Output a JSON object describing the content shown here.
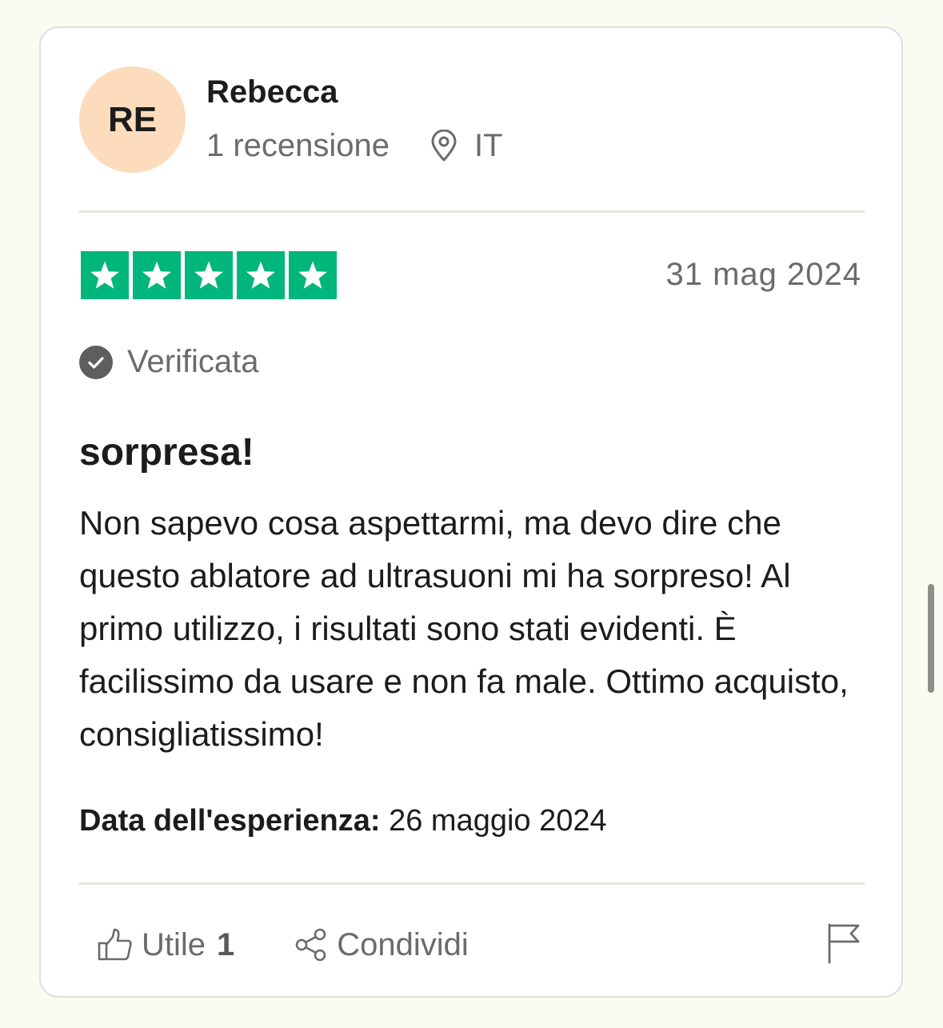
{
  "reviewer": {
    "initials": "RE",
    "name": "Rebecca",
    "review_count": "1 recensione",
    "country": "IT",
    "avatar_color": "#fcdcbc"
  },
  "review": {
    "rating": 5,
    "rating_max": 5,
    "star_color": "#00b67a",
    "date": "31 mag 2024",
    "verified_label": "Verificata",
    "title": "sorpresa!",
    "body": "Non sapevo cosa aspettarmi, ma devo dire che questo ablatore ad ultrasuoni mi ha sorpreso! Al primo utilizzo, i risultati sono stati evidenti. È facilissimo da usare e non fa male. Ottimo acquisto, consigliatissimo!",
    "experience_label": "Data dell'esperienza:",
    "experience_date": "26 maggio 2024"
  },
  "actions": {
    "useful_label": "Utile",
    "useful_count": "1",
    "share_label": "Condividi"
  },
  "icons": {
    "location": "location-pin-icon",
    "verified": "check-circle-icon",
    "useful": "thumbs-up-icon",
    "share": "share-icon",
    "report": "flag-icon",
    "star": "star-icon"
  }
}
